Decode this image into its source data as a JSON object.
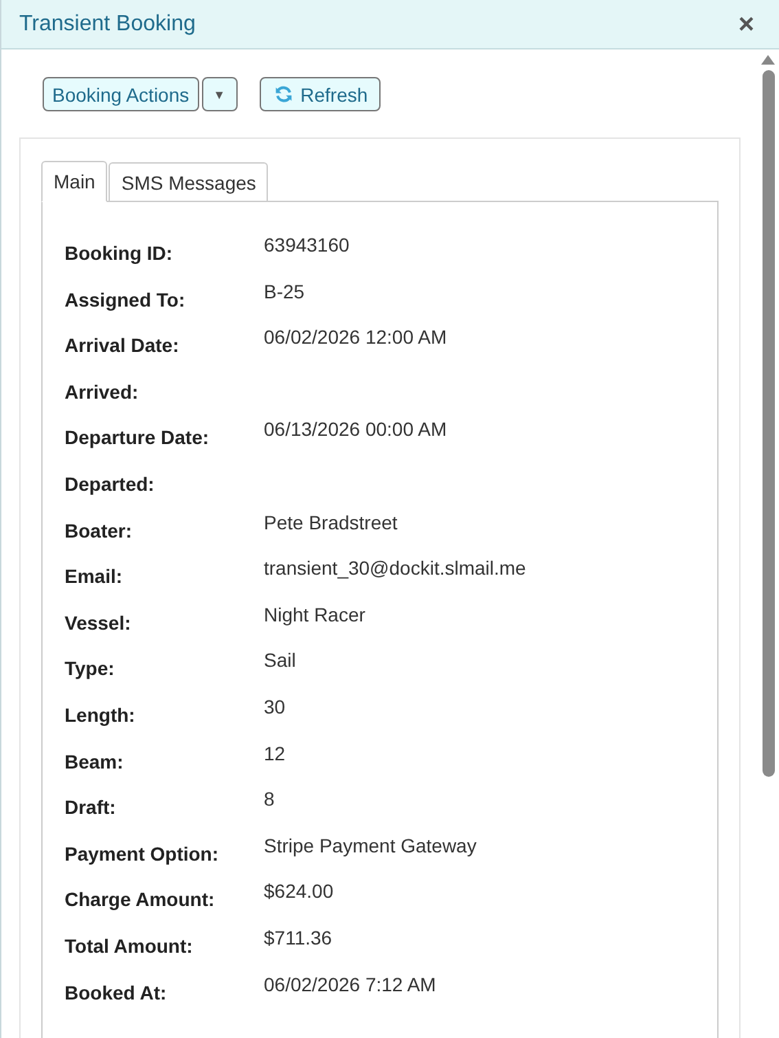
{
  "window": {
    "title": "Transient Booking",
    "close": "×"
  },
  "toolbar": {
    "actions": "Booking Actions",
    "dropdown": "▼",
    "refresh": "Refresh"
  },
  "tabs": [
    {
      "label": "Main",
      "selected": true
    },
    {
      "label": "SMS Messages",
      "selected": false
    }
  ],
  "fields": [
    {
      "label": "Booking ID:",
      "value": "63943160"
    },
    {
      "label": "Assigned To:",
      "value": "B-25"
    },
    {
      "label": "Arrival Date:",
      "value": "06/02/2026 12:00 AM"
    },
    {
      "label": "Arrived:"
    },
    {
      "label": "Departure Date:",
      "value": "06/13/2026 00:00 AM"
    },
    {
      "label": "Departed:"
    },
    {
      "label": "Boater:",
      "value": "Pete Bradstreet"
    },
    {
      "label": "Email:",
      "value": "transient_30@dockit.slmail.me"
    },
    {
      "label": "Vessel:",
      "value": "Night Racer"
    },
    {
      "label": "Type:",
      "value": "Sail"
    },
    {
      "label": "Length:",
      "value": "30"
    },
    {
      "label": "Beam:",
      "value": "12"
    },
    {
      "label": "Draft:",
      "value": "8"
    },
    {
      "label": "Payment Option:",
      "value": "Stripe Payment Gateway"
    },
    {
      "label": "Charge Amount:",
      "value": "$624.00"
    },
    {
      "label": "Total Amount:",
      "value": "$711.36"
    },
    {
      "label": "Booked At:",
      "value": "06/02/2026 7:12 AM"
    }
  ]
}
